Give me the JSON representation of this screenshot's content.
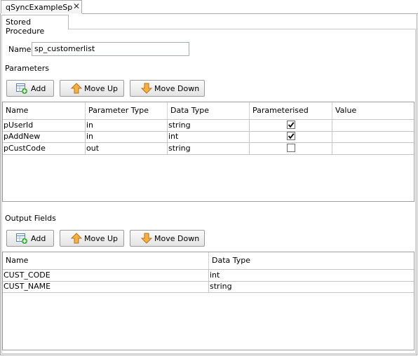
{
  "editor_tab": {
    "title": "qSyncExampleSp",
    "close_glyph": "✕"
  },
  "inner_tab": {
    "title": "Stored Procedure"
  },
  "name_field": {
    "label": "Name",
    "value": "sp_customerlist"
  },
  "parameters": {
    "section_label": "Parameters",
    "toolbar": {
      "add": "Add",
      "move_up": "Move Up",
      "move_down": "Move Down"
    },
    "columns": [
      "Name",
      "Parameter Type",
      "Data Type",
      "Parameterised",
      "Value"
    ],
    "rows": [
      {
        "name": "pUserId",
        "param_type": "in",
        "data_type": "string",
        "parameterised": true,
        "value": ""
      },
      {
        "name": "pAddNew",
        "param_type": "in",
        "data_type": "int",
        "parameterised": true,
        "value": ""
      },
      {
        "name": "pCustCode",
        "param_type": "out",
        "data_type": "string",
        "parameterised": false,
        "value": ""
      }
    ]
  },
  "output_fields": {
    "section_label": "Output Fields",
    "toolbar": {
      "add": "Add",
      "move_up": "Move Up",
      "move_down": "Move Down"
    },
    "columns": [
      "Name",
      "Data Type"
    ],
    "rows": [
      {
        "name": "CUST_CODE",
        "data_type": "int"
      },
      {
        "name": "CUST_NAME",
        "data_type": "string"
      }
    ]
  },
  "icons": {
    "add": "table-add-icon",
    "move_up": "arrow-up-icon",
    "move_down": "arrow-down-icon",
    "check": "checkmark-icon"
  },
  "colors": {
    "arrow_fill": "#f5b041",
    "arrow_stroke": "#b8741a",
    "add_badge": "#3cae3c",
    "table_icon": "#4f7fbf"
  }
}
